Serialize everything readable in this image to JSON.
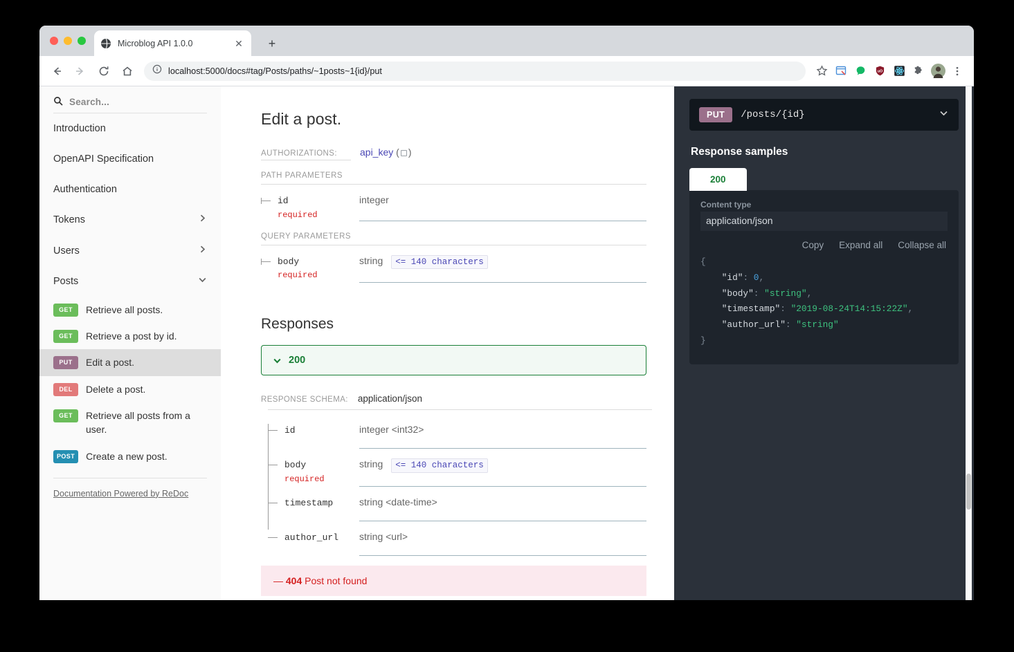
{
  "browser": {
    "tab_title": "Microblog API 1.0.0",
    "tab_close": "✕",
    "new_tab": "+",
    "url_full": "localhost:5000/docs#tag/Posts/paths/~1posts~1{id}/put",
    "nav": {
      "back": "back-arrow",
      "forward": "forward-arrow",
      "reload": "reload",
      "home": "home"
    },
    "extensions": [
      "bookmark-star-icon",
      "window-capture-icon",
      "green-dot-icon",
      "ublock-shield-icon",
      "react-devtools-icon",
      "puzzle-extensions-icon",
      "profile-avatar",
      "chrome-menu-icon"
    ]
  },
  "sidebar": {
    "search_placeholder": "Search...",
    "nav_items": [
      {
        "label": "Introduction",
        "chevron": ""
      },
      {
        "label": "OpenAPI Specification",
        "chevron": ""
      },
      {
        "label": "Authentication",
        "chevron": ""
      },
      {
        "label": "Tokens",
        "chevron": "right"
      },
      {
        "label": "Users",
        "chevron": "right"
      },
      {
        "label": "Posts",
        "chevron": "down"
      }
    ],
    "operations": [
      {
        "method": "GET",
        "label": "Retrieve all posts.",
        "active": false
      },
      {
        "method": "GET",
        "label": "Retrieve a post by id.",
        "active": false
      },
      {
        "method": "PUT",
        "label": "Edit a post.",
        "active": true
      },
      {
        "method": "DEL",
        "label": "Delete a post.",
        "active": false
      },
      {
        "method": "GET",
        "label": "Retrieve all posts from a user.",
        "active": false
      },
      {
        "method": "POST",
        "label": "Create a new post.",
        "active": false
      }
    ],
    "footer_link": "Documentation Powered by ReDoc"
  },
  "main": {
    "title": "Edit a post.",
    "authorizations_label": "AUTHORIZATIONS:",
    "authorizations_value": "api_key",
    "path_params_label": "PATH PARAMETERS",
    "path_params": [
      {
        "name": "id",
        "required": "required",
        "type": "integer",
        "constraint": ""
      }
    ],
    "query_params_label": "QUERY PARAMETERS",
    "query_params": [
      {
        "name": "body",
        "required": "required",
        "type": "string",
        "constraint": "<= 140 characters"
      }
    ],
    "responses_title": "Responses",
    "response_200_code": "200",
    "response_schema_label": "RESPONSE SCHEMA:",
    "response_schema_value": "application/json",
    "schema_fields": [
      {
        "name": "id",
        "required": "",
        "type": "integer <int32>",
        "constraint": ""
      },
      {
        "name": "body",
        "required": "required",
        "type": "string",
        "constraint": "<= 140 characters"
      },
      {
        "name": "timestamp",
        "required": "",
        "type": "string <date-time>",
        "constraint": ""
      },
      {
        "name": "author_url",
        "required": "",
        "type": "string <url>",
        "constraint": ""
      }
    ],
    "error_dash": "—",
    "error_code": "404",
    "error_text": "Post not found"
  },
  "right_panel": {
    "method": "PUT",
    "path": "/posts/{id}",
    "response_samples_title": "Response samples",
    "sample_tab": "200",
    "content_type_label": "Content type",
    "content_type_value": "application/json",
    "actions": {
      "copy": "Copy",
      "expand": "Expand all",
      "collapse": "Collapse all"
    },
    "json_sample": {
      "open_brace": "{",
      "close_brace": "}",
      "lines": [
        {
          "key": "\"id\"",
          "value": "0",
          "kind": "num",
          "comma": ","
        },
        {
          "key": "\"body\"",
          "value": "\"string\"",
          "kind": "str",
          "comma": ","
        },
        {
          "key": "\"timestamp\"",
          "value": "\"2019-08-24T14:15:22Z\"",
          "kind": "str",
          "comma": ","
        },
        {
          "key": "\"author_url\"",
          "value": "\"string\"",
          "kind": "str",
          "comma": ""
        }
      ]
    }
  },
  "colors": {
    "get": "#6bbd5b",
    "put": "#9b708b",
    "del": "#e27a7a",
    "post": "#248fb2",
    "success": "#1a7f37",
    "error": "#d41f1f",
    "link": "#4a47b5",
    "panel_bg": "#2b313a",
    "code_bg": "#1e242c"
  }
}
